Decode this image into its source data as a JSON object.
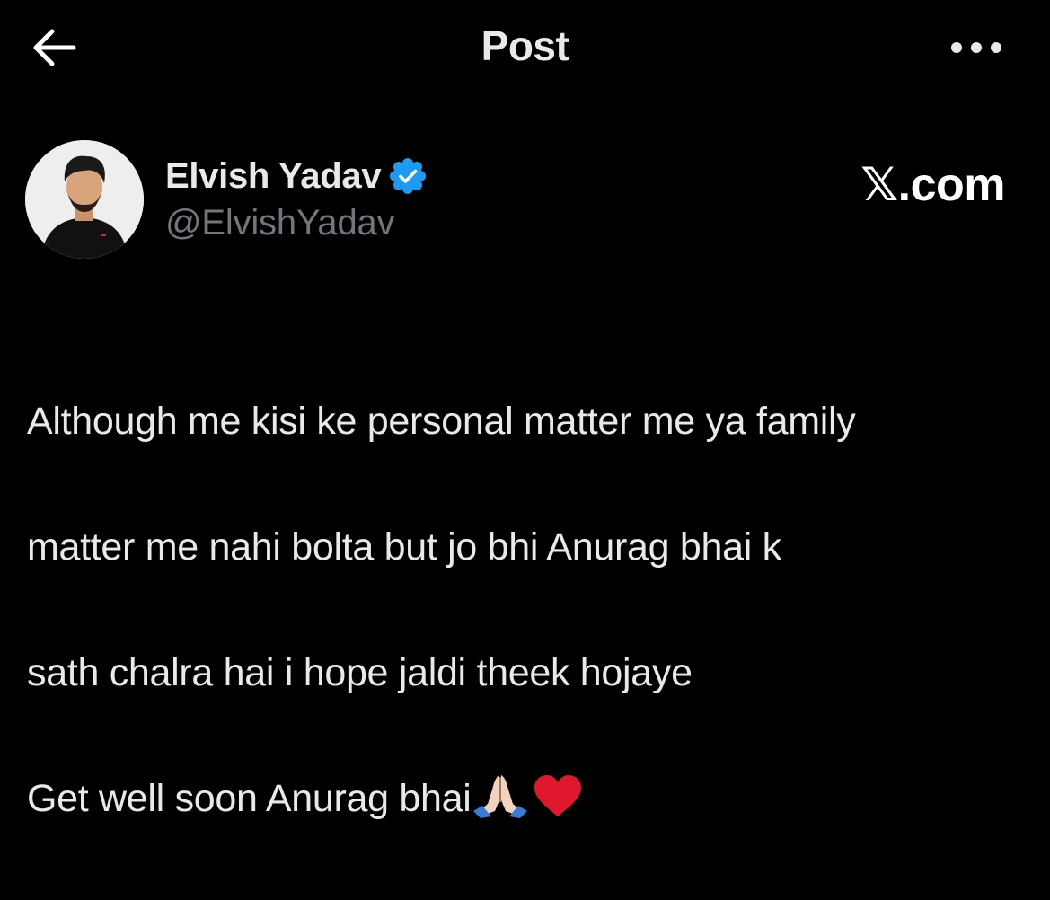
{
  "header": {
    "title": "Post",
    "back_icon": "arrow-left-icon",
    "more_icon": "more-horizontal-icon"
  },
  "author": {
    "display_name": "Elvish Yadav",
    "handle": "@ElvishYadav",
    "verified": true,
    "verified_color": "#1d9bf0"
  },
  "watermark": "𝕏.com",
  "post": {
    "lines": [
      "Although me kisi ke personal matter me ya family",
      "matter me nahi bolta but jo bhi Anurag bhai k",
      "sath chalra hai i hope jaldi theek hojaye",
      "Get well soon Anurag bhai"
    ],
    "emojis": [
      "folded-hands-icon",
      "red-heart-icon"
    ]
  },
  "colors": {
    "background": "#000000",
    "text_primary": "#e7e9ea",
    "text_secondary": "#71767b",
    "accent": "#1d9bf0",
    "heart": "#e0182d"
  }
}
